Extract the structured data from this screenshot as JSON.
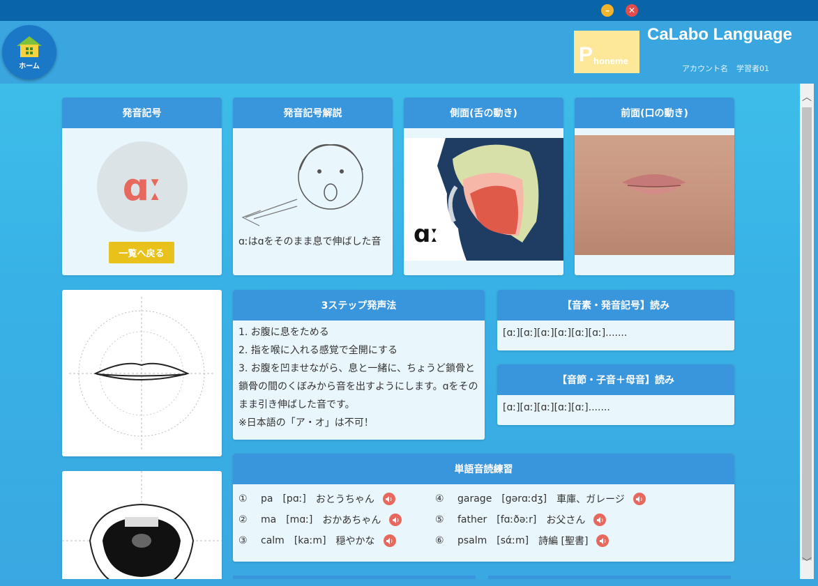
{
  "window": {
    "minimize_icon": "minimize-icon",
    "close_icon": "close-icon"
  },
  "header": {
    "home_label": "ホーム",
    "logo_big": "P",
    "logo_small": "honeme",
    "app_title": "CaLabo Language",
    "account_label": "アカウント名",
    "account_name": "学習者01"
  },
  "symbol_card": {
    "title": "発音記号",
    "symbol": "ɑː",
    "back_button": "一覧へ戻る"
  },
  "explain_card": {
    "title": "発音記号解説",
    "text": "ɑːはɑをそのまま息で伸ばした音"
  },
  "side_card": {
    "title": "側面(舌の動き)",
    "symbol": "ɑː"
  },
  "front_card": {
    "title": "前面(口の動き)"
  },
  "steps_card": {
    "title": "3ステップ発声法",
    "lines": [
      "1. お腹に息をためる",
      "2. 指を喉に入れる感覚で全開にする",
      "3. お腹を凹ませながら、息と一緒に、ちょうど鎖骨と鎖骨の間のくぼみから音を出すようにします。ɑをそのまま引き伸ばした音です。",
      "※日本語の「ア・オ」は不可！"
    ]
  },
  "phoneme_card": {
    "title": "【音素・発音記号】読み",
    "text": "[ɑː][ɑː][ɑː][ɑː][ɑː][ɑː]......."
  },
  "syllable_card": {
    "title": "【音節・子音＋母音】読み",
    "text": "[ɑː][ɑː][ɑː][ɑː][ɑː]......."
  },
  "words_card": {
    "title": "単語音読練習",
    "items": [
      {
        "num": "①",
        "word": "pa",
        "ipa": "[pɑː]",
        "meaning": "おとうちゃん"
      },
      {
        "num": "②",
        "word": "ma",
        "ipa": "[mɑː]",
        "meaning": "おかあちゃん"
      },
      {
        "num": "③",
        "word": "calm",
        "ipa": "[kaːm]",
        "meaning": "穏やかな"
      },
      {
        "num": "④",
        "word": "garage",
        "ipa": "[gərɑːdʒ]",
        "meaning": "車庫、ガレージ"
      },
      {
        "num": "⑤",
        "word": "father",
        "ipa": "[fɑːðəːr]",
        "meaning": "お父さん"
      },
      {
        "num": "⑥",
        "word": "psalm",
        "ipa": "[sάːm]",
        "meaning": "詩編 [聖書]"
      }
    ]
  },
  "colors": {
    "accent": "#3a96dc",
    "symbol": "#e7685d",
    "button": "#e8c21a",
    "logo": "#fde89a"
  }
}
